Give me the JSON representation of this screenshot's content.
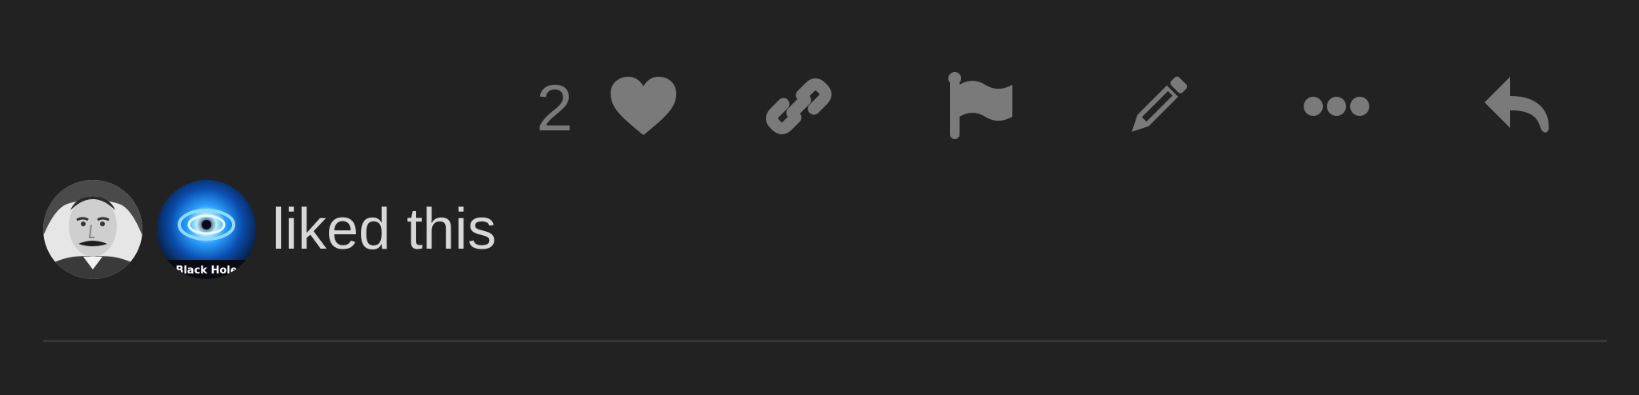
{
  "post_actions": {
    "like_count": "2",
    "icons": [
      "heart-icon",
      "link-icon",
      "flag-icon",
      "pencil-icon",
      "more-icon",
      "reply-icon"
    ]
  },
  "likes": {
    "text": "liked this",
    "avatars": [
      {
        "name": "user-avatar-1"
      },
      {
        "name": "user-avatar-2",
        "caption": "Black Hole"
      }
    ]
  },
  "colors": {
    "background": "#222222",
    "icon": "#7a7a7a",
    "text": "#d8d8d8",
    "divider": "#363636"
  }
}
